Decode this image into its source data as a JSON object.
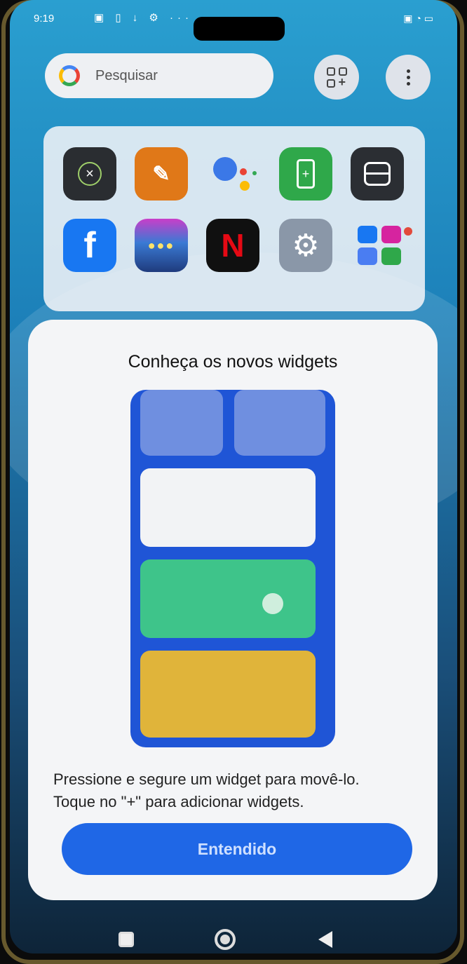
{
  "status_bar": {
    "time": "9:19"
  },
  "search": {
    "placeholder": "Pesquisar"
  },
  "dialog": {
    "title": "Conheça os novos widgets",
    "body_line1": "Pressione e segure um widget para movê-lo.",
    "body_line2": "Toque no \"+\" para adicionar widgets.",
    "confirm_label": "Entendido"
  },
  "colors": {
    "accent_button": "#1f67e6",
    "widget_blue": "#6f8fe0",
    "widget_green": "#3ec48a",
    "widget_yellow": "#e0b43a"
  }
}
